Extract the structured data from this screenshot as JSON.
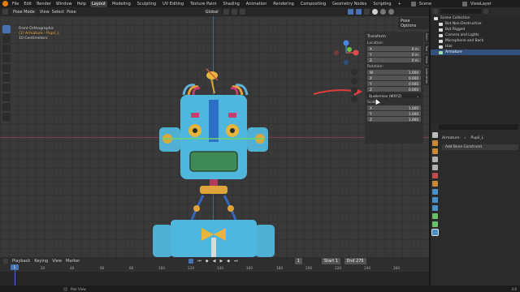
{
  "menu": [
    "File",
    "Edit",
    "Render",
    "Window",
    "Help"
  ],
  "workspaces": [
    "Layout",
    "Modeling",
    "Sculpting",
    "UV Editing",
    "Texture Paint",
    "Shading",
    "Animation",
    "Rendering",
    "Compositing",
    "Geometry Nodes",
    "Scripting"
  ],
  "scene": "Scene",
  "view_layer": "ViewLayer",
  "viewport": {
    "mode": "Pose Mode",
    "menus": [
      "View",
      "Select",
      "Pose"
    ],
    "orientation": "Global",
    "options": "Pose Options",
    "info": {
      "view": "Front Orthographic",
      "selection": "(1) Armature : Pupil_L",
      "scale": "10 Centimeters"
    }
  },
  "npanel": {
    "tabs": [
      "Item",
      "Tool",
      "View",
      "Animation"
    ],
    "transform": "Transform",
    "location": {
      "label": "Location:",
      "rows": [
        {
          "axis": "X",
          "value": "0 m"
        },
        {
          "axis": "Y",
          "value": "0 m"
        },
        {
          "axis": "Z",
          "value": "0 m"
        }
      ]
    },
    "rotation": {
      "label": "Rotation:",
      "rows": [
        {
          "axis": "W",
          "value": "1.000"
        },
        {
          "axis": "X",
          "value": "0.000"
        },
        {
          "axis": "Y",
          "value": "0.000"
        },
        {
          "axis": "Z",
          "value": "0.000"
        }
      ]
    },
    "rotation_mode": "Quaternion (WXYZ)",
    "scale": {
      "label": "Scale:",
      "rows": [
        {
          "axis": "X",
          "value": "1.000"
        },
        {
          "axis": "Y",
          "value": "1.000"
        },
        {
          "axis": "Z",
          "value": "1.000"
        }
      ]
    }
  },
  "outliner": {
    "root": "Scene Collection",
    "items": [
      "Bot Non-Destructive",
      "Bot Rigged",
      "Camera and Lights",
      "Microphone and Back",
      "Hair",
      "Armature"
    ]
  },
  "properties": {
    "breadcrumb": [
      "Armature",
      "Pupil_L"
    ],
    "add_constraint": "Add Bone Constraint"
  },
  "timeline": {
    "menus": [
      "Playback",
      "Keying",
      "View",
      "Marker"
    ],
    "current_frame": "1",
    "start_label": "Start",
    "start": "1",
    "end_label": "End",
    "end": "275",
    "ruler": [
      "1",
      "20",
      "40",
      "60",
      "80",
      "100",
      "120",
      "140",
      "160",
      "180",
      "200",
      "220",
      "240",
      "260"
    ]
  },
  "status": {
    "text": "Pan View",
    "version": "3.6"
  }
}
